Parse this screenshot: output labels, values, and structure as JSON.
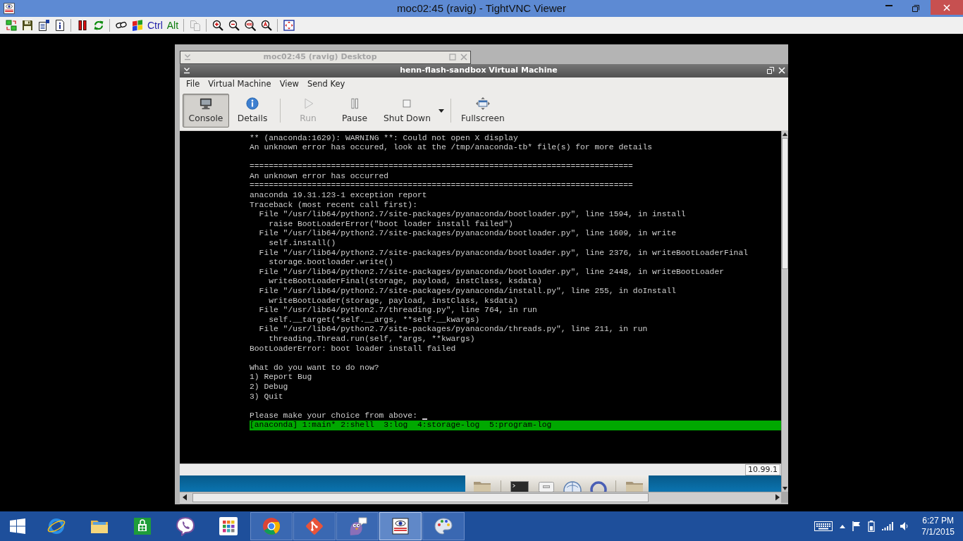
{
  "window": {
    "title": "moc02:45 (ravig) - TightVNC Viewer"
  },
  "toolbar_groups": [
    [
      {
        "kind": "icon",
        "disabled": false
      },
      {
        "kind": "icon",
        "disabled": false
      },
      {
        "kind": "icon",
        "disabled": false
      },
      {
        "kind": "icon",
        "disabled": false
      }
    ],
    [
      {
        "kind": "icon",
        "disabled": false
      },
      {
        "kind": "icon",
        "disabled": false
      }
    ],
    [
      {
        "kind": "icon",
        "disabled": false
      },
      {
        "kind": "icon",
        "disabled": false
      },
      {
        "kind": "key",
        "label": "Ctrl",
        "color": "#1c1ca8",
        "disabled": false
      },
      {
        "kind": "key",
        "label": "Alt",
        "color": "#0a7a0a",
        "disabled": false
      }
    ],
    [
      {
        "kind": "icon",
        "disabled": true
      }
    ],
    [
      {
        "kind": "icon",
        "disabled": false
      },
      {
        "kind": "icon",
        "disabled": false
      },
      {
        "kind": "icon",
        "disabled": false
      },
      {
        "kind": "icon",
        "disabled": false
      }
    ],
    [
      {
        "kind": "icon",
        "disabled": false
      }
    ]
  ],
  "remote_desktop": {
    "background_window": {
      "title": "moc02:45 (ravig) Desktop",
      "active": false
    },
    "vm_window": {
      "title": "henn-flash-sandbox Virtual Machine",
      "active": true,
      "menu": [
        "File",
        "Virtual Machine",
        "View",
        "Send Key"
      ],
      "toolbar_groups": [
        [
          {
            "label": "Console",
            "selected": true,
            "disabled": false,
            "dropdown": false
          },
          {
            "label": "Details",
            "selected": false,
            "disabled": false,
            "dropdown": false
          }
        ],
        [
          {
            "label": "Run",
            "selected": false,
            "disabled": true,
            "dropdown": false
          },
          {
            "label": "Pause",
            "selected": false,
            "disabled": false,
            "dropdown": false
          },
          {
            "label": "Shut Down",
            "selected": false,
            "disabled": false,
            "dropdown": true
          }
        ],
        [
          {
            "label": "Fullscreen",
            "selected": false,
            "disabled": false,
            "dropdown": false
          }
        ]
      ],
      "console": {
        "blocks": [
          [
            "** (anaconda:1629): WARNING **: Could not open X display",
            "An unknown error has occured, look at the /tmp/anaconda-tb* file(s) for more details"
          ],
          [
            "================================================================================",
            "An unknown error has occurred",
            "================================================================================",
            "anaconda 19.31.123-1 exception report",
            "Traceback (most recent call first):",
            "  File \"/usr/lib64/python2.7/site-packages/pyanaconda/bootloader.py\", line 1594, in install",
            "    raise BootLoaderError(\"boot loader install failed\")",
            "  File \"/usr/lib64/python2.7/site-packages/pyanaconda/bootloader.py\", line 1609, in write",
            "    self.install()",
            "  File \"/usr/lib64/python2.7/site-packages/pyanaconda/bootloader.py\", line 2376, in writeBootLoaderFinal",
            "    storage.bootloader.write()",
            "  File \"/usr/lib64/python2.7/site-packages/pyanaconda/bootloader.py\", line 2448, in writeBootLoader",
            "    writeBootLoaderFinal(storage, payload, instClass, ksdata)",
            "  File \"/usr/lib64/python2.7/site-packages/pyanaconda/install.py\", line 255, in doInstall",
            "    writeBootLoader(storage, payload, instClass, ksdata)",
            "  File \"/usr/lib64/python2.7/threading.py\", line 764, in run",
            "    self.__target(*self.__args, **self.__kwargs)",
            "  File \"/usr/lib64/python2.7/site-packages/pyanaconda/threads.py\", line 211, in run",
            "    threading.Thread.run(self, *args, **kwargs)",
            "BootLoaderError: boot loader install failed"
          ],
          [
            "What do you want to do now?",
            "1) Report Bug",
            "2) Debug",
            "3) Quit"
          ]
        ],
        "prompt": {
          "text": "Please make your choice from above:",
          "cursor": true
        },
        "status_line": "[anaconda] 1:main* 2:shell  3:log  4:storage-log  5:program-log"
      },
      "status_bar": {
        "address": "10.99.1"
      }
    }
  },
  "taskbar": {
    "apps": [
      {
        "running": false,
        "selected": false
      },
      {
        "running": false,
        "selected": false
      },
      {
        "running": false,
        "selected": false
      },
      {
        "running": false,
        "selected": false
      },
      {
        "running": false,
        "selected": false
      },
      {
        "running": true,
        "selected": false
      },
      {
        "running": true,
        "selected": false
      },
      {
        "running": true,
        "selected": false
      },
      {
        "running": true,
        "selected": true
      },
      {
        "running": true,
        "selected": false
      }
    ],
    "clock": {
      "time": "6:27 PM",
      "date": "7/1/2015"
    }
  }
}
